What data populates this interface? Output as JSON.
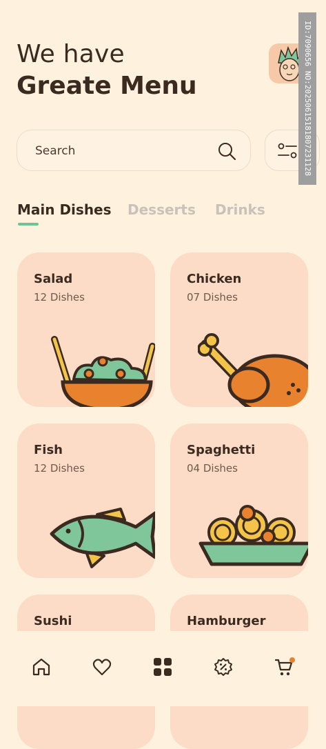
{
  "header": {
    "line1": "We have",
    "line2": "Greate Menu"
  },
  "search": {
    "placeholder": "Search"
  },
  "tabs": [
    {
      "label": "Main Dishes",
      "active": true
    },
    {
      "label": "Desserts",
      "active": false
    },
    {
      "label": "Drinks",
      "active": false
    }
  ],
  "cards": [
    {
      "title": "Salad",
      "count": "12 Dishes"
    },
    {
      "title": "Chicken",
      "count": "07 Dishes"
    },
    {
      "title": "Fish",
      "count": "12 Dishes"
    },
    {
      "title": "Spaghetti",
      "count": "04 Dishes"
    },
    {
      "title": "Sushi",
      "count": ""
    },
    {
      "title": "Hamburger",
      "count": ""
    }
  ],
  "nav": [
    "home-icon",
    "heart-icon",
    "grid-icon",
    "discount-icon",
    "cart-icon"
  ],
  "watermark": "ID:7090656 NO:20250615181807231128",
  "colors": {
    "background": "#fef2df",
    "card": "#fcdcc6",
    "accent": "#6fc197",
    "orange": "#e8822e",
    "dark": "#3b2a20"
  }
}
